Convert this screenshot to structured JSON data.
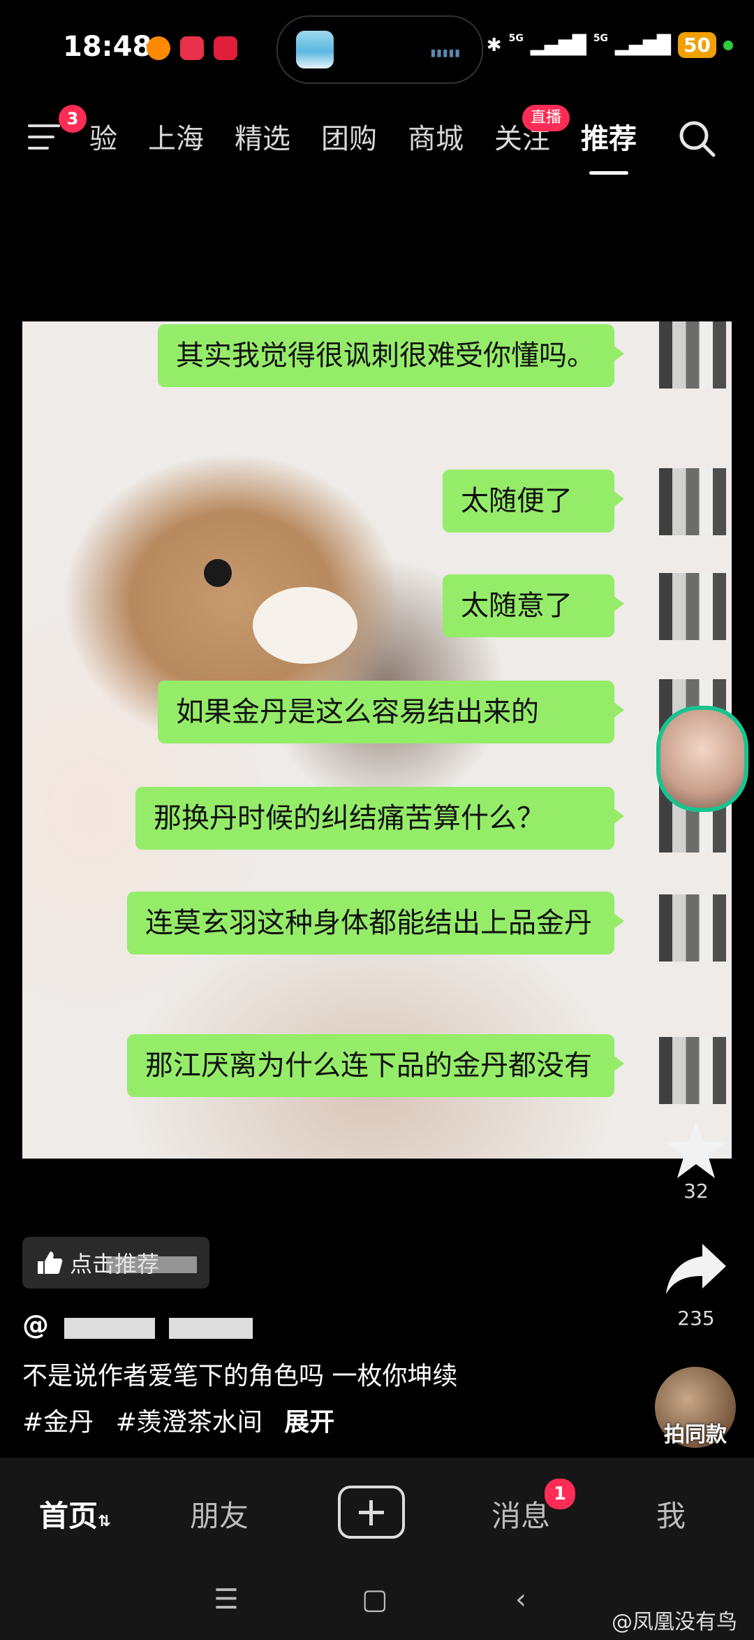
{
  "status_bar": {
    "time": "18:48",
    "network_1": "5G",
    "network_2": "5G",
    "battery": "50"
  },
  "top_nav": {
    "menu_badge": "3",
    "tabs": [
      "验",
      "上海",
      "精选",
      "团购",
      "商城",
      "关注",
      "推荐"
    ],
    "live_badge": "直播",
    "active_tab": "推荐"
  },
  "video": {
    "messages": [
      "其实我觉得很讽刺很难受你懂吗。",
      "太随便了",
      "太随意了",
      "如果金丹是这么容易结出来的",
      "那换丹时候的纠结痛苦算什么？",
      "连莫玄羽这种身体都能结出上品金丹",
      "那江厌离为什么连下品的金丹都没有"
    ]
  },
  "side_actions": {
    "favorite_count": "32",
    "share_count": "235",
    "same_style_label": "拍同款"
  },
  "caption": {
    "recommend_chip": "点击推荐",
    "author_prefix": "@",
    "text": "不是说作者爱笔下的角色吗 一枚你坤续",
    "hashtags": [
      "#金丹",
      "#羡澄茶水间"
    ],
    "expand": "展开"
  },
  "bottom_nav": {
    "home": "首页",
    "friends": "朋友",
    "messages": "消息",
    "messages_badge": "1",
    "me": "我"
  },
  "watermark": "@凤凰没有鸟",
  "colors": {
    "bubble": "#95ec69",
    "badge": "#ff2d55",
    "background": "#000000"
  }
}
